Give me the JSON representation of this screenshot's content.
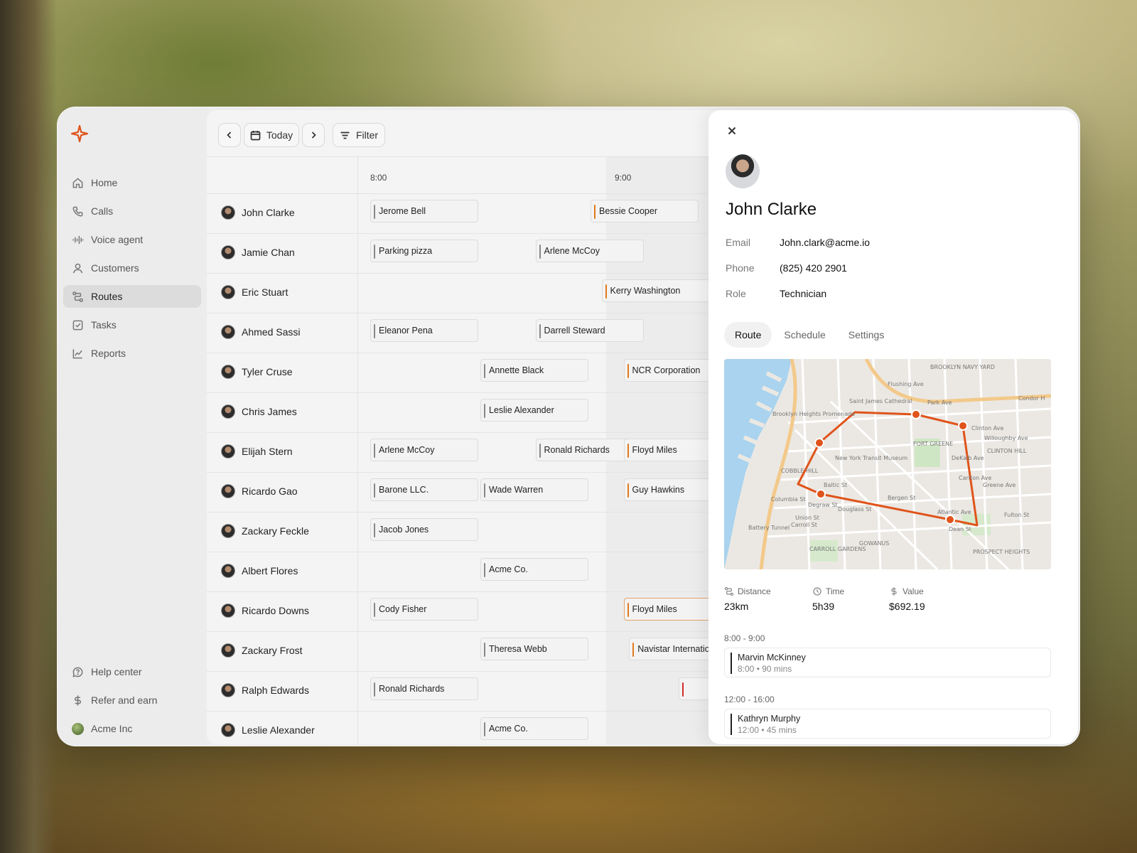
{
  "sidebar": {
    "items": [
      {
        "label": "Home",
        "icon": "home-icon"
      },
      {
        "label": "Calls",
        "icon": "phone-icon"
      },
      {
        "label": "Voice agent",
        "icon": "waveform-icon"
      },
      {
        "label": "Customers",
        "icon": "user-icon"
      },
      {
        "label": "Routes",
        "icon": "route-icon",
        "active": true
      },
      {
        "label": "Tasks",
        "icon": "checkbox-icon"
      },
      {
        "label": "Reports",
        "icon": "chart-line-icon"
      }
    ],
    "bottom": [
      {
        "label": "Help center",
        "icon": "help-icon"
      },
      {
        "label": "Refer and earn",
        "icon": "dollar-icon"
      },
      {
        "label": "Acme Inc",
        "icon": "org-avatar"
      }
    ]
  },
  "toolbar": {
    "today_label": "Today",
    "filter_label": "Filter"
  },
  "calendar": {
    "times": [
      "8:00",
      "9:00"
    ],
    "rows": [
      {
        "name": "John Clarke",
        "events": [
          {
            "label": "Jerome Bell",
            "col": 0
          },
          {
            "label": "Bessie Cooper",
            "col": 2,
            "color": "orange"
          }
        ]
      },
      {
        "name": "Jamie Chan",
        "events": [
          {
            "label": "Parking pizza",
            "col": 0
          },
          {
            "label": "Arlene McCoy",
            "col": 1.5
          }
        ]
      },
      {
        "name": "Eric Stuart",
        "events": [
          {
            "label": "Kerry Washington",
            "col": 2.1,
            "color": "orange"
          }
        ]
      },
      {
        "name": "Ahmed Sassi",
        "events": [
          {
            "label": "Eleanor Pena",
            "col": 0
          },
          {
            "label": "Darrell Steward",
            "col": 1.5
          }
        ]
      },
      {
        "name": "Tyler Cruse",
        "events": [
          {
            "label": "Annette Black",
            "col": 1
          },
          {
            "label": "NCR Corporation",
            "col": 2.3,
            "color": "orange"
          }
        ]
      },
      {
        "name": "Chris James",
        "events": [
          {
            "label": "Leslie Alexander",
            "col": 1
          }
        ]
      },
      {
        "name": "Elijah Stern",
        "events": [
          {
            "label": "Arlene McCoy",
            "col": 0
          },
          {
            "label": "Ronald Richards",
            "col": 1.5
          },
          {
            "label": "Floyd Miles",
            "col": 2.3,
            "color": "orange"
          }
        ]
      },
      {
        "name": "Ricardo Gao",
        "events": [
          {
            "label": "Barone LLC.",
            "col": 0
          },
          {
            "label": "Wade Warren",
            "col": 1
          },
          {
            "label": "Guy Hawkins",
            "col": 2.3,
            "color": "orange"
          }
        ]
      },
      {
        "name": "Zackary Feckle",
        "events": [
          {
            "label": "Jacob Jones",
            "col": 0
          }
        ]
      },
      {
        "name": "Albert Flores",
        "events": [
          {
            "label": "Acme Co.",
            "col": 1
          }
        ]
      },
      {
        "name": "Ricardo Downs",
        "events": [
          {
            "label": "Cody Fisher",
            "col": 0
          },
          {
            "label": "Floyd Miles",
            "col": 2.3,
            "color": "orange",
            "highlight": true
          }
        ]
      },
      {
        "name": "Zackary Frost",
        "events": [
          {
            "label": "Theresa Webb",
            "col": 1
          },
          {
            "label": "Navistar International",
            "col": 2.35,
            "color": "orange"
          }
        ]
      },
      {
        "name": "Ralph Edwards",
        "events": [
          {
            "label": "Ronald Richards",
            "col": 0
          },
          {
            "label": "",
            "col": 2.8,
            "color": "red"
          }
        ]
      },
      {
        "name": "Leslie Alexander",
        "events": [
          {
            "label": "Acme Co.",
            "col": 1
          }
        ]
      }
    ]
  },
  "detail": {
    "name": "John Clarke",
    "info": [
      {
        "label": "Email",
        "value": "John.clark@acme.io"
      },
      {
        "label": "Phone",
        "value": "(825) 420 2901"
      },
      {
        "label": "Role",
        "value": "Technician"
      }
    ],
    "tabs": [
      {
        "label": "Route",
        "active": true
      },
      {
        "label": "Schedule"
      },
      {
        "label": "Settings"
      }
    ],
    "map_labels": {
      "navy_yard": "BROOKLYN NAVY YARD",
      "flushing": "Flushing Ave",
      "park": "Park Ave",
      "cathedral": "Saint James Cathedral",
      "heights": "Brooklyn Heights Promenade",
      "museum": "New York Transit Museum",
      "fort_greene": "FORT GREENE",
      "clinton_hill": "CLINTON HILL",
      "willoughby": "Willoughby Ave",
      "dekalb": "DeKalb Ave",
      "cobble": "COBBLE HILL",
      "gowanus": "GOWANUS",
      "carroll": "CARROLL GARDENS",
      "prospect": "PROSPECT HEIGHTS",
      "atlantic": "Atlantic Ave",
      "fulton": "Fulton St",
      "dean": "Dean St",
      "bergen": "Bergen St",
      "union": "Union St",
      "degraw": "Degraw St",
      "douglass": "Douglass St",
      "baltic": "Baltic St",
      "carroll_st": "Carroll St",
      "columbia": "Columbia St",
      "battery": "Battery Tunnel",
      "carlton": "Carlton Ave",
      "clinton": "Clinton Ave",
      "greene": "Greene Ave",
      "condor": "Condor H"
    },
    "stats": [
      {
        "label": "Distance",
        "value": "23km",
        "icon": "route-icon"
      },
      {
        "label": "Time",
        "value": "5h39",
        "icon": "clock-icon"
      },
      {
        "label": "Value",
        "value": "$692.19",
        "icon": "dollar-icon"
      }
    ],
    "slots": [
      {
        "range": "8:00 - 9:00",
        "name": "Marvin McKinney",
        "time": "8:00",
        "duration": "90 mins"
      },
      {
        "range": "12:00 - 16:00",
        "name": "Kathryn Murphy",
        "time": "12:00",
        "duration": "45 mins"
      }
    ]
  },
  "colors": {
    "accent": "#e0541b",
    "event_orange": "#e07a1f",
    "event_red": "#d12b2b"
  }
}
